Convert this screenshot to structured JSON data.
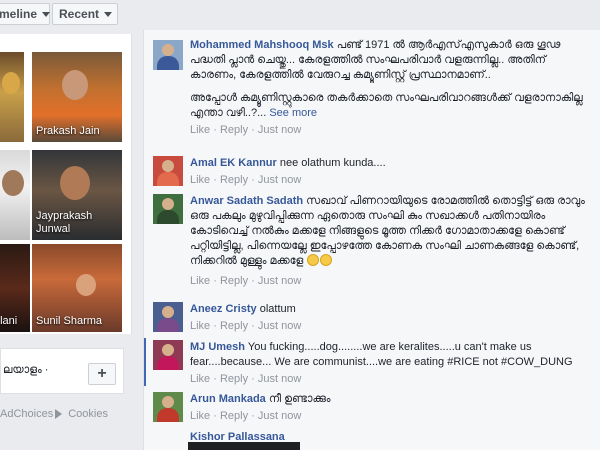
{
  "toolbar": {
    "timeline_label": "meline",
    "recent_label": "Recent"
  },
  "photos": [
    {
      "name": ""
    },
    {
      "name": "Prakash Jain"
    },
    {
      "name": ""
    },
    {
      "name": "Jayprakash Junwal"
    },
    {
      "name": "plani"
    },
    {
      "name": "Sunil Sharma"
    }
  ],
  "sidebar": {
    "language_text": "ലയാളം ·",
    "plus_label": "+",
    "adchoices_label": "AdChoices",
    "cookies_label": "Cookies"
  },
  "comments": [
    {
      "author": "Mohammed Mahshooq Msk",
      "text": "പണ്ട് 1971 ൽ ആർഎസ്എസുകാർ ഒരു ഗൂഢ പദ്ധതി പ്ലാൻ ചെയ്തു... കേരളത്തിൽ സംഘപരിവാർ വളരുന്നില്ല.. അതിന് കാരണം, കേരളത്തിൽ വേരുറച്ച കമ്യൂണിസ്റ്റ് പ്രസ്ഥാനമാണ്..",
      "text2": "അപ്പോൾ കമ്യൂണിസ്റ്റുകാരെ തകർക്കാതെ സംഘപരിവാറങ്ങൾക്ക് വളരാനാകില്ല എന്താ വഴി..?...",
      "see_more": "See more",
      "like": "Like",
      "reply": "Reply",
      "time": "Just now"
    },
    {
      "author": "Amal EK Kannur",
      "text": "nee olathum kunda....",
      "like": "Like",
      "reply": "Reply",
      "time": "Just now"
    },
    {
      "author": "Anwar Sadath Sadath",
      "text": "സഖാവ് പിണറായിയുടെ രോമത്തിൽ തൊട്ടിട്ട് ഒരു രാവും ഒരു പകലും മുഴുവിപ്പിക്കുന്ന ഏതൊരു സംഘി കും സഖാക്കൾ പതിനായിരം കോടിവെച്ച് നൽകും മക്കളേ നിങ്ങളുടെ മൂത്ത നിക്കർ ഗോമാതാക്കളേ കൊണ്ട് പറ്റിയിട്ടില്ല, പിന്നെയല്ലേ ഇപ്പോഴത്തേ കോണക സംഘി ചാണകങ്ങളേ കൊണ്ട്, നിക്കറിൽ മുള്ളും മക്കളേ",
      "like": "Like",
      "reply": "Reply",
      "time": "Just now"
    },
    {
      "author": "Aneez Cristy",
      "text": "olattum",
      "like": "Like",
      "reply": "Reply",
      "time": "Just now"
    },
    {
      "author": "MJ Umesh",
      "text": "You fucking.....dog........we are keralites.....u can't make us fear....because... We are communist....we are eating #RICE not #COW_DUNG",
      "like": "Like",
      "reply": "Reply",
      "time": "Just now"
    },
    {
      "author": "Arun Mankada",
      "text": "നീ ഉണ്ടാക്കും",
      "like": "Like",
      "reply": "Reply",
      "time": "Just now"
    },
    {
      "author": "Kishor Pallassana",
      "text": ""
    }
  ],
  "separator": "·",
  "colors": {
    "link": "#365899",
    "meta": "#90949c",
    "panel": "#f6f7f9",
    "page": "#e9ebee"
  }
}
